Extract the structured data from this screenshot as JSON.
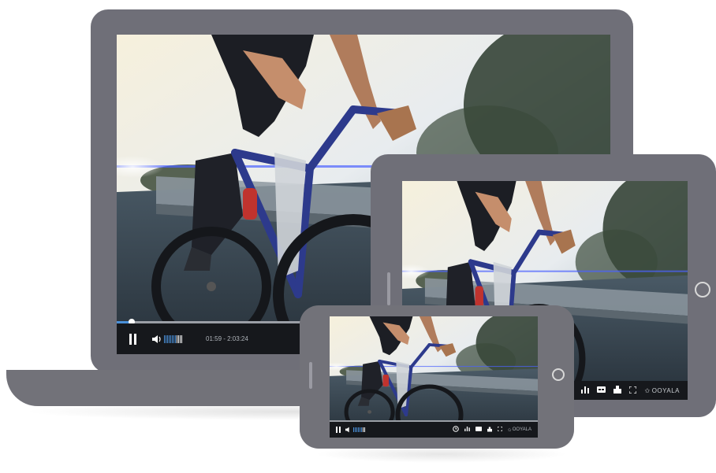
{
  "laptop": {
    "time_label": "01:59 - 2:03:24",
    "progress": 0.03
  },
  "tablet": {
    "brand": "OOYALA"
  },
  "phone": {
    "brand": "OOYALA"
  },
  "colors": {
    "device_frame": "#6f6f78",
    "control_bar": "#16181c",
    "accent": "#4a90d9"
  },
  "icons": [
    "pause-icon",
    "volume-icon",
    "stats-icon",
    "closed-captions-icon",
    "share-icon",
    "fullscreen-icon",
    "ooyala-logo-icon",
    "clock-icon"
  ]
}
